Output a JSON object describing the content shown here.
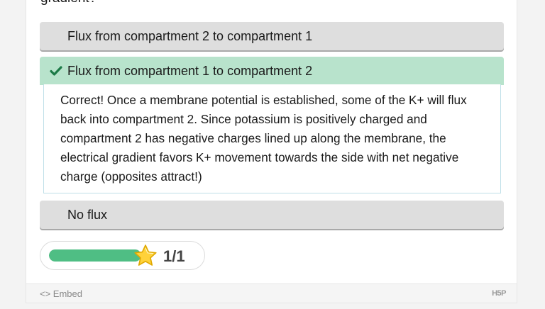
{
  "question": {
    "text": "gradient?"
  },
  "alternatives": [
    {
      "label": "Flux from compartment 2 to compartment 1",
      "state": "default"
    },
    {
      "label": "Flux from compartment 1 to compartment 2",
      "state": "correct"
    },
    {
      "label": "No flux",
      "state": "default"
    }
  ],
  "feedback": {
    "text": "Correct!  Once a membrane potential is established, some of the K+ will flux back into compartment 2.  Since potassium is positively charged and compartment 2 has negative charges lined up along the membrane, the electrical gradient favors K+ movement towards the side with net negative charge (opposites attract!)"
  },
  "score": {
    "text": "1/1",
    "progress_fraction": 1.0,
    "icon": "star-icon"
  },
  "footer": {
    "embed_label": "<> Embed",
    "logo_text": "H5P"
  },
  "colors": {
    "correct_bg": "#b8e3cc",
    "check_green": "#1c7a47",
    "progress_green": "#4fbe84",
    "star_yellow": "#ffd23a"
  }
}
